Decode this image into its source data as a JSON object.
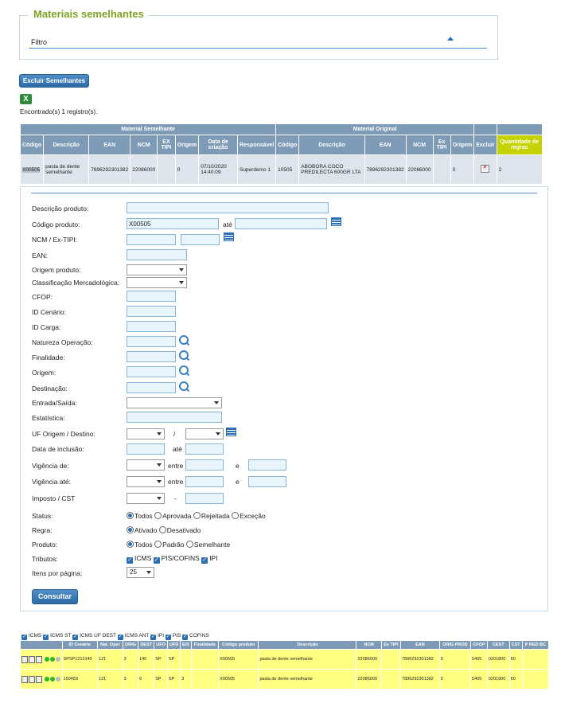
{
  "section": {
    "title": "Materiais semelhantes",
    "filter_label": "Filtro"
  },
  "actions": {
    "excluir_label": "Excluir Semelhantes",
    "export_icon": "excel-icon",
    "found_text": "Encontrado(s) 1 registro(s)."
  },
  "similar_table": {
    "group_semelhante": "Material Semelhante",
    "group_original": "Material Original",
    "headers": [
      "Código",
      "Descrição",
      "EAN",
      "NCM",
      "EX TIPI",
      "Origem",
      "Data de criação",
      "Responsável",
      "Código",
      "Descrição",
      "EAN",
      "NCM",
      "Ex TIPI",
      "Origem",
      "Excluir",
      "Quantidade de regras"
    ],
    "row": [
      "X00505",
      "pasta de dente semelhante",
      "7896292301382",
      "22086000",
      "",
      "0",
      "07/10/2020 14:40:09",
      "Superdemo 1",
      "10505",
      "ABOBORA COCO PREDILECTA 600GR LTA",
      "7896292301382",
      "22086000",
      "",
      "0",
      "",
      "2"
    ]
  },
  "form": {
    "descricao_produto": "Descrição produto:",
    "codigo_produto": "Código produto:",
    "codigo_value": "X00505",
    "ate": "até",
    "ncm": "NCM / Ex-TIPI:",
    "ean": "EAN:",
    "origem_produto": "Origem produto:",
    "classificacao": "Classificação Mercadológica:",
    "cfop": "CFOP:",
    "id_cenario": "ID Cenário:",
    "id_carga": "ID Carga:",
    "natureza": "Natureza Operação:",
    "finalidade": "Finalidade:",
    "origem": "Origem:",
    "destinacao": "Destinação:",
    "entrada_saida": "Entrada/Saída:",
    "estatistica": "Estatística:",
    "uf": "UF Origem / Destino:",
    "slash": "/",
    "data_inclusao": "Data de inclusão:",
    "vigencia_de": "Vigência de:",
    "vigencia_ate": "Vigência até:",
    "entre": "entre",
    "e": "e",
    "imposto": "Imposto / CST",
    "dash": "-",
    "status": "Status:",
    "status_options": [
      "Todos",
      "Aprovada",
      "Rejeitada",
      "Exceção"
    ],
    "regra": "Regra:",
    "regra_options": [
      "Ativado",
      "Desativado"
    ],
    "produto": "Produto:",
    "produto_options": [
      "Todos",
      "Padrão",
      "Semelhante"
    ],
    "tributos": "Tributos:",
    "tributos_options": [
      "ICMS",
      "PIS/COFINS",
      "IPI"
    ],
    "itens": "Itens por página:",
    "itens_value": "25",
    "consultar": "Consultar"
  },
  "bottom": {
    "checks": [
      "ICMS",
      "ICMS ST",
      "ICMS UF DEST",
      "ICMS ANT",
      "IPI",
      "PIS",
      "COFINS"
    ],
    "headers": [
      "",
      "ID Cenário",
      "Nat. Oper",
      "ORIG",
      "DEST",
      "UFO",
      "UFD",
      "E/S",
      "Finalidade",
      "Código produto",
      "Descrição",
      "NCM",
      "Ex TIPI",
      "EAN",
      "ORIG PROD",
      "CFOP",
      "CEST",
      "CST",
      "P RED BC"
    ],
    "rows": [
      [
        "",
        "SPSP1213140",
        "121",
        "3",
        "140",
        "SP",
        "SP",
        "",
        "",
        "X00505",
        "pasta de dente semelhante",
        "22086000",
        "",
        "7896292301382",
        "0",
        "5405",
        "0201800",
        "60",
        ""
      ],
      [
        "",
        "150459",
        "121",
        "3",
        "6",
        "SP",
        "SP",
        "3",
        "",
        "X00505",
        "pasta de dente semelhante",
        "22086000",
        "",
        "7896292301382",
        "0",
        "5405",
        "0201900",
        "60",
        ""
      ]
    ]
  }
}
